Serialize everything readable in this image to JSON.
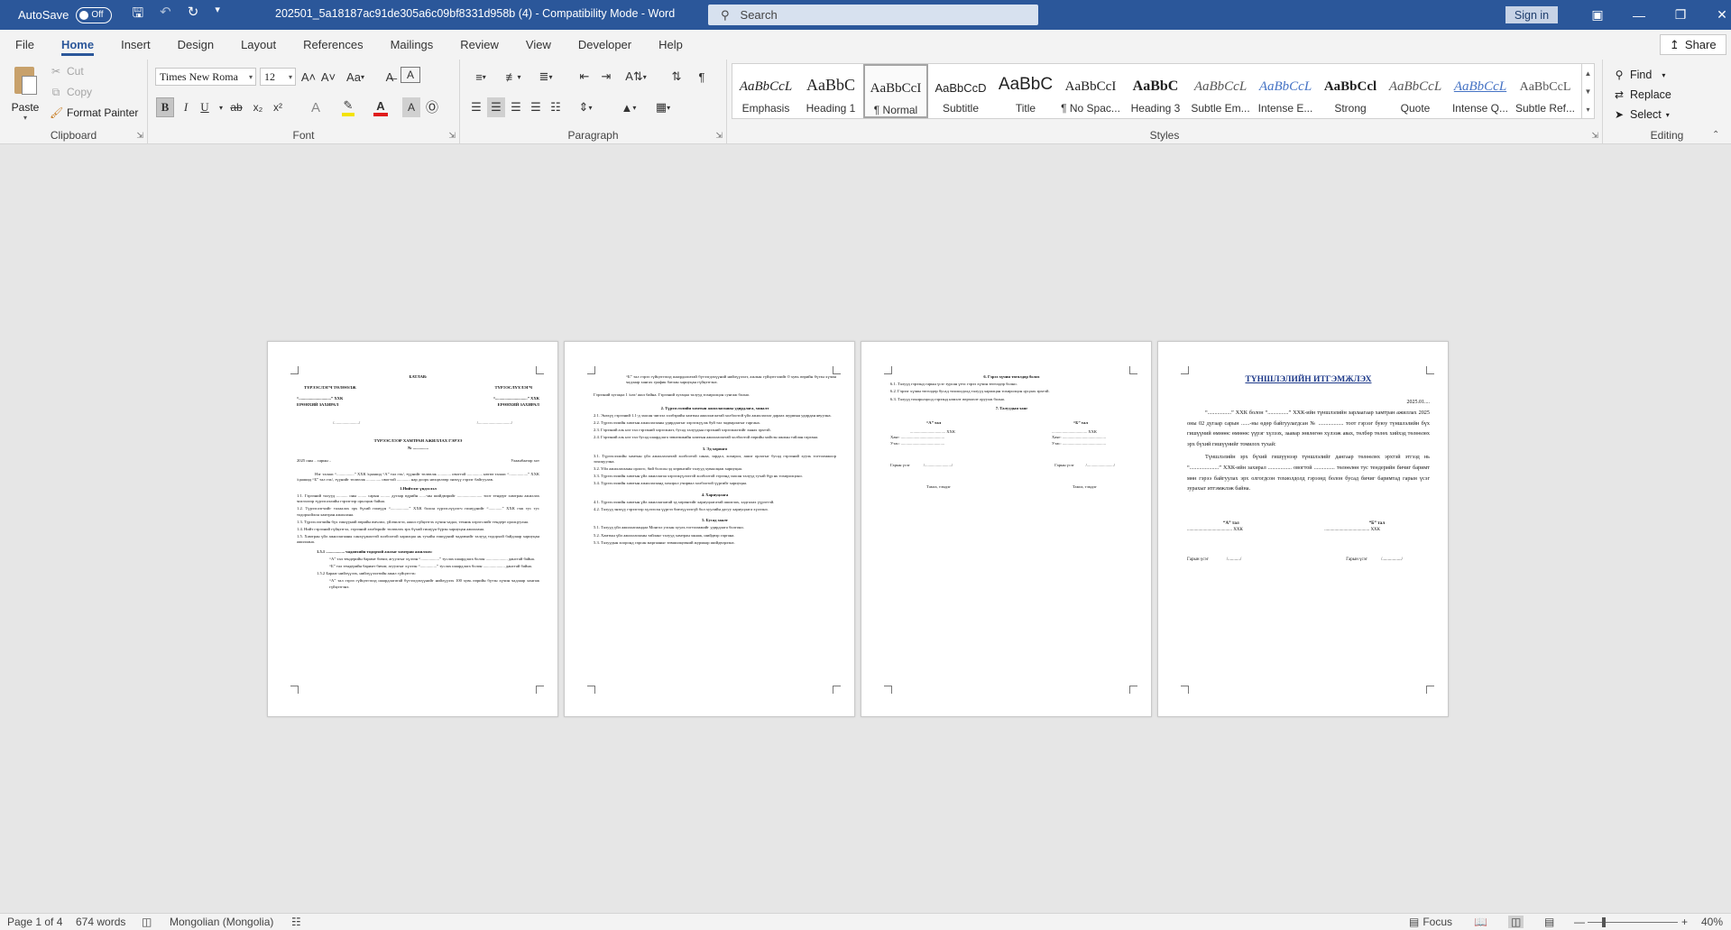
{
  "titlebar": {
    "autosave_label": "AutoSave",
    "autosave_state": "Off",
    "document_title": "202501_5a18187ac91de305a6c09bf8331d958b (4)  -  Compatibility Mode  -  Word",
    "search_placeholder": "Search",
    "signin_label": "Sign in"
  },
  "tabs": [
    "File",
    "Home",
    "Insert",
    "Design",
    "Layout",
    "References",
    "Mailings",
    "Review",
    "View",
    "Developer",
    "Help"
  ],
  "active_tab": "Home",
  "share_label": "Share",
  "clipboard": {
    "paste": "Paste",
    "cut": "Cut",
    "copy": "Copy",
    "format_painter": "Format Painter",
    "label": "Clipboard"
  },
  "font": {
    "family": "Times New Roma",
    "size": "12",
    "label": "Font",
    "grow": "A˄",
    "shrink": "A˅",
    "case": "Aa",
    "bold": "B",
    "italic": "I",
    "underline": "U",
    "strike": "ab",
    "subscript": "x₂",
    "superscript": "x²"
  },
  "paragraph": {
    "label": "Paragraph"
  },
  "styles": {
    "label": "Styles",
    "items": [
      {
        "preview": "AaBbCcL",
        "name": "Emphasis"
      },
      {
        "preview": "AaBbC",
        "name": "Heading 1"
      },
      {
        "preview": "AaBbCcI",
        "name": "¶ Normal"
      },
      {
        "preview": "AaBbCcD",
        "name": "Subtitle"
      },
      {
        "preview": "AaBbC",
        "name": "Title"
      },
      {
        "preview": "AaBbCcI",
        "name": "¶ No Spac..."
      },
      {
        "preview": "AaBbC",
        "name": "Heading 3"
      },
      {
        "preview": "AaBbCcL",
        "name": "Subtle Em..."
      },
      {
        "preview": "AaBbCcL",
        "name": "Intense E..."
      },
      {
        "preview": "AaBbCcl",
        "name": "Strong"
      },
      {
        "preview": "AaBbCcL",
        "name": "Quote"
      },
      {
        "preview": "AaBbCcL",
        "name": "Intense Q..."
      },
      {
        "preview": "AaBbCcL",
        "name": "Subtle Ref..."
      }
    ],
    "selected": "¶ Normal"
  },
  "editing": {
    "label": "Editing",
    "find": "Find",
    "replace": "Replace",
    "select": "Select"
  },
  "pages": {
    "p1": {
      "approve": "БАТЛАВ:",
      "lessor": "ТҮРЭЭСЛЭГЧ ТӨЛӨӨЛЖ",
      "lessee": "ТҮРЭЭСЛҮҮЛЭГЧ",
      "company_a": "“...............................” ХХК",
      "director": "ЕРӨНХИЙ ЗАХИРАЛ",
      "sign_a": "/......................../",
      "sign_b": "/................................/",
      "contract_title": "ТҮРЭЭСЛЭЭР ХАМТРАН АЖИЛЛАХ ГЭРЭЭ",
      "contract_no": "№ ...............",
      "date": "2025 оны .. сарын ..",
      "city": "Улаанбаатар хот",
      "intro": "Нэг талаас “.................” ХХК /цаашид “А” тал гэх/, түүнийг төлөөлж ............. овогтой ............... нөгөө талаас “..................” ХХК /цаашид “Б” тал гэх/, түүнийг төлөөлж .............. овогтой ............. нар доорх нөхцөлөөр энэхүү гэрээг байгуулав.",
      "s1": "1.Нийтлэг үндэслэл",
      "s1_1": "1.1. Гэрээний талууд ........... оны ........ сарын ......... дугаар өдрийн ......-ны шийдвэрийг ........................ тоот тендерт хамтран ажиллах чиглэлээр түрээслэлийн гэрээгээр оролцож байна.",
      "s1_2": "1.2. Түрээслэгчийг талаалах эрх бүхий гишүүн “..................” ХХК болон түрээслүүлэгч гишүүнийг “.............” ХХК гэж тус тус тодорхойлон хамтран ажиллана.",
      "s1_3": "1.3. Түрээслэгчийн бүх гишүүний өөрийн өмчлөл, үйлчилгээ, ажил гүйцэтгэх хүчин чадал, техник хэрэгслийг тендерт оролцуулна.",
      "s1_4": "1.4. Нийт гэрээний гүйцэтгэл, гэрээний хөлбөрийг төлөөлөх эрх бүхий гишүүн бүрэн хариуцан ажиллана.",
      "s1_5": "1.5. Хамтран үйл ажиллагааны санхүүжилтэй холбоотой харилцаа нь тухайн гишүүний чадавхийг талууд тодорхой байдлаар хариуцан ажиллана.",
      "s1_5_1": "1.5.1 .................. чадавхийн тодорхой ажлыг хамтран ажиллах:",
      "b1": "“А” тал тендерийн баримт бичиг, агуулгыг хүлээн “..................” туслах шаардлага болон ..................... данстай байна.",
      "b2": "“Б” тал тендерийн баримт бичиг, агуулгыг хүлээн “................” туслах шаардлага болон ..................... данстай байна.",
      "s1_5_2": "1.5.2 Барааг нийлүүлэх, нийлүүлэлтийн ажил гүйцэтгэх:",
      "b3": "“А” тал гэрээ гүйцэтгэхэд шаардлагатай бүтээгдэхүүнийг нийлүүлэх 100 хувь өөрийн бүтэн хүчин чадлаар хангаж гүйцэтгэнэ."
    },
    "p2": {
      "b1": "“Б” тал гэрээ гүйцэтгэхэд шаардлагатай бүтээгдэхүүний нийлүүлэлт, ажлын гүйцэтгэлийг 0 хувь өөрийн бүтэн хүчин чадлаар хангах график батлан хариуцан гүйцэтгэнэ.",
      "note": "Гэрээний хугацаа 1 /нэг/ жил байна. Гэрээний хугацаа талууд тохиролцон сунгаж болно.",
      "s2": "2. Түрээслэлийн хамтын ажиллагааны удирдлага, хяналт",
      "s2_1": "2.1. Энэхүү гэрээний 1.1-д заасан чиглэл хэлбэрийн хамтын ажиллагаатай холбоотой үйл ажиллагааг дараах журмын удирдан явуулна.",
      "s2_2": "2.2. Түрээслэлийн хамтын ажиллагааны удирдлагыг хэрэгжүүлж буй тал чадварлагыг гаргана.",
      "s2_3": "2.3. Гэрээний аль нэг тал гэрээний хэрэгжилт, бусад талуудын гэрээний хэрэгжилтийг хянах эрхтэй.",
      "s2_4": "2.4. Гэрээний аль нэг тал бусад шаардлага зөвлөмжийн хамтын ажиллагаатай холбоотой өөрийн хийсэн ажлын тайлан гаргана.",
      "s3": "3. Эд хөрөнгө",
      "s3_1": "3.1. Түрээслэлийн хамтын үйл ажиллагаатай холбоотой санаа, зардал, хохирол, ашиг орлогыг бусад гэрээний хууль тогтоомжоор зохицуулна.",
      "s3_2": "3.2. Үйл ажиллагааны орлого, бий болсон эд хөрөнгийг талууд хуваалцаж хариуцна.",
      "s3_3": "3.3. Түрээслэлийн хамтын үйл ажиллагаа хэрэгжүүлэхтэй холбоотой гэрээнд заасан талууд тухай бүр нь тохиролцоно.",
      "s3_4": "3.4. Түрээслэлийн хамтын ажиллагаанд хохирол учирвал холбоотой үүргийг хариуцна.",
      "s4": "4. Хариуцлага",
      "s4_1": "4.1. Түрээслэлийн хамтын үйл ажиллагаатай эд хөрөнгийг хариуцлагатай ашиглах, хадгалах үүрэгтэй.",
      "s4_2": "4.2. Талууд энэхүү гэрээгээр хүлээсэн үүргээ биелүүлээгүй бол хуулийн дагуу хариуцлага хүлээнэ.",
      "s5": "5. Бусад заалт",
      "s5_1": "5.1. Талууд үйл ажиллагаандаа Монгол улсын хууль тогтоомжийг удирдлага болгоно.",
      "s5_2": "5.2. Хамтын үйл ажиллагааны тайланг талууд хамтран хянаж, шийдвэр гаргана.",
      "s5_3": "5.3. Талуудын хооронд гарсан маргааныг зөвшилцөөний журмаар шийдвэрлэнэ."
    },
    "p3": {
      "s6": "6. Гэрээ хүчин төгөлдөр болох",
      "s6_1": "6.1. Талууд гэрээнд гарын үсэг зурсан үеэс гэрээ хүчин төгөлдөр болно.",
      "s6_2": "6.2. Гэрээг хүчин төгөлдөр бусад тохиолдолд талууд харилцан тохиролцон цуцлах эрхтэй.",
      "s6_3": "6.3. Талууд тохиролцоод гэрээнд нэмэлт өөрчлөлт оруулж болно.",
      "s7": "7. Талуудын хаяг",
      "party_a": "“А” тал",
      "party_b": "“Б” тал",
      "company": ".................................. ХХК",
      "addr": "Хаяг: ..........................................",
      "phone": "Утас: ..........................................",
      "sign": "Гарын үсэг",
      "sign_line": "/........................../",
      "stamp": "Тамга, тэмдэг"
    },
    "p4": {
      "title": "ТҮНШЛЭЛИЙН ИТГЭМЖЛЭХ",
      "date": "2025.01....",
      "body1": "“.................” ХХК болон “...............” ХХК-ийн түншлэлийн зарлаагаар хамтран ажиллах 2025 оны 02 дугаар сарын ......-ны өдөр байгуулагдсан № .................. тоот гэрээг буюу түншлэлийн бүх гишүүний өмнөөс өмнөөс үүрэг хүлээх, заавар зөвлөгөө хүлээж авах, төлбөр төлөх хийхэд төлөөлөх эрх бүхий гишүүнийг томилох тухай:",
      "body2": "Түншлэлийн эрх бүхий гишүүнээр түншлэлийг дангаар төлөөлөх эрхтэй этгээд нь “.....................” ХХК-ийн захирал ................. овогтой ............... төлөөлөн тус тендерийн бичиг баримт мөн гэрээ байгуулах эрх олгогдсон тохиолдолд гэрээнд болон бусад бичиг баримтад гарын үсэг зурахыг итгэмжлэж байна.",
      "party_a": "“А” тал",
      "party_b": "“Б” тал",
      "company": "........................................ ХХК",
      "sign": "Гарын үсэг",
      "sign_line": "/.........../",
      "sign_line_b": "/................./"
    }
  },
  "statusbar": {
    "page": "Page 1 of 4",
    "words": "674 words",
    "language": "Mongolian (Mongolia)",
    "focus": "Focus",
    "zoom": "40%"
  }
}
